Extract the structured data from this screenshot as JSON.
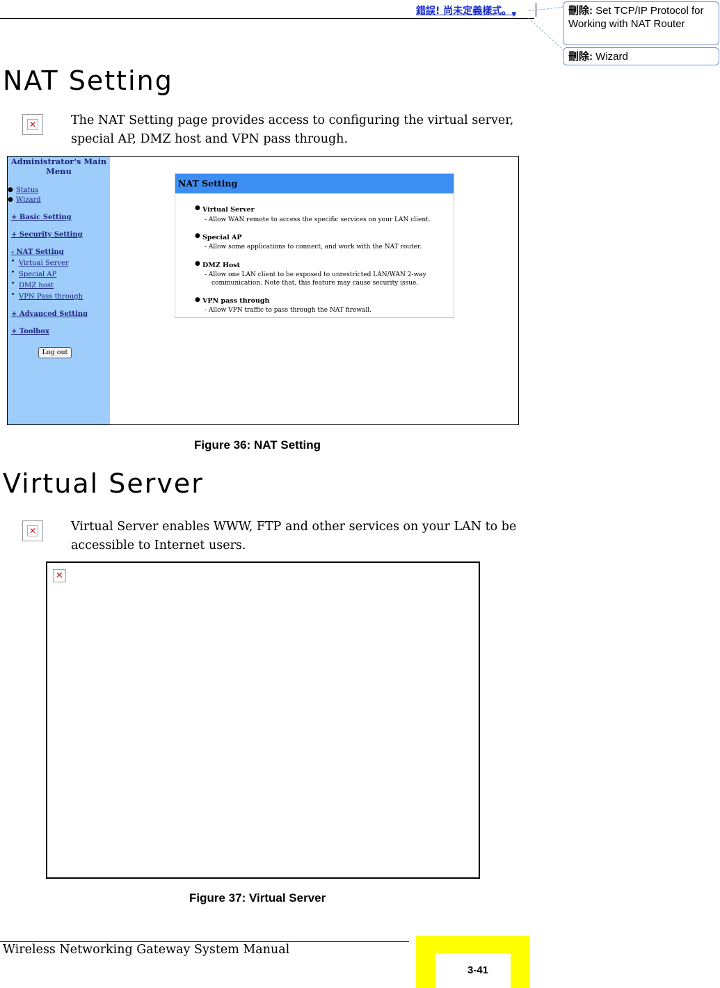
{
  "header": {
    "error_text": "錯誤! 尚未定義樣式。"
  },
  "balloons": [
    {
      "prefix": "刪除:",
      "text": "Set TCP/IP Protocol for Working with NAT Router"
    },
    {
      "prefix": "刪除:",
      "text": "Wizard"
    }
  ],
  "section1": {
    "heading": "NAT Setting",
    "paragraph": "The NAT Setting page provides access to configuring the virtual server, special AP, DMZ host and VPN pass through."
  },
  "figure36": {
    "menu": {
      "title": "Administrator's Main Menu",
      "status": "Status",
      "wizard": "Wizard",
      "basic": "+ Basic Setting",
      "security": "+ Security Setting",
      "nat": "- NAT Setting",
      "virtual_server": "Virtual Server",
      "special_ap": "Special AP",
      "dmz": "DMZ host",
      "vpn": "VPN Pass through",
      "advanced": "+ Advanced Setting",
      "toolbox": "+ Toolbox",
      "logout": "Log out"
    },
    "panel": {
      "title": "NAT Setting",
      "items": [
        {
          "name": "Virtual Server",
          "desc": "- Allow WAN remote to access the specific services on your LAN client."
        },
        {
          "name": "Special AP",
          "desc": "- Allow some applications to connect, and work with the NAT router."
        },
        {
          "name": "DMZ Host",
          "desc": "- Allow one LAN client to be exposed to unrestricted LAN/WAN 2-way",
          "desc2": "communication. Note that, this feature may cause security issue."
        },
        {
          "name": "VPN pass through",
          "desc": "- Allow VPN traffic to pass through the NAT firewall."
        }
      ]
    },
    "caption": "Figure 36: NAT Setting"
  },
  "section2": {
    "heading": "Virtual Server",
    "paragraph": "Virtual Server enables WWW, FTP and other services on your LAN to be accessible to Internet users."
  },
  "figure37": {
    "caption": "Figure 37: Virtual Server"
  },
  "footer": {
    "title": "Wireless Networking Gateway System Manual",
    "page": "3-41"
  }
}
